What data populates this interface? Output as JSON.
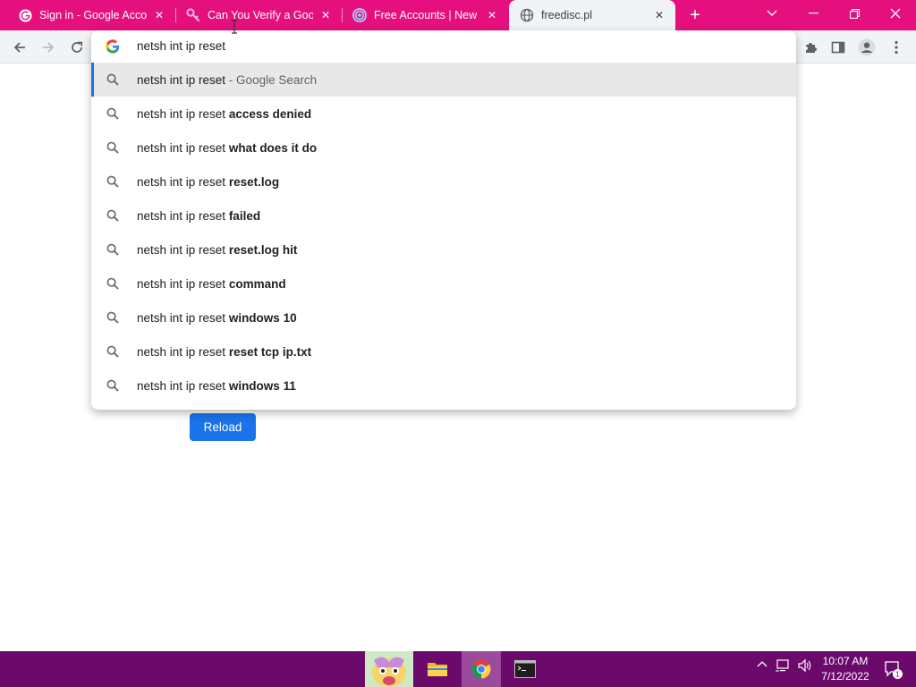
{
  "tabs": [
    {
      "title": "Sign in - Google Accou",
      "icon": "google-icon"
    },
    {
      "title": "Can You Verify a Googl",
      "icon": "pink-key-icon"
    },
    {
      "title": "Free Accounts | New Fr",
      "icon": "swirl-icon"
    },
    {
      "title": "freedisc.pl",
      "icon": "globe-icon",
      "active": true
    }
  ],
  "omnibox": {
    "value": "netsh int ip reset",
    "suggestions": [
      {
        "prefix": "netsh int ip reset",
        "bold": "",
        "suffix": " - Google Search",
        "selected": true
      },
      {
        "prefix": "netsh int ip reset ",
        "bold": "access denied",
        "suffix": ""
      },
      {
        "prefix": "netsh int ip reset ",
        "bold": "what does it do",
        "suffix": ""
      },
      {
        "prefix": "netsh int ip reset ",
        "bold": "reset.log",
        "suffix": ""
      },
      {
        "prefix": "netsh int ip reset ",
        "bold": "failed",
        "suffix": ""
      },
      {
        "prefix": "netsh int ip reset ",
        "bold": "reset.log hit",
        "suffix": ""
      },
      {
        "prefix": "netsh int ip reset ",
        "bold": "command",
        "suffix": ""
      },
      {
        "prefix": "netsh int ip reset ",
        "bold": "windows 10",
        "suffix": ""
      },
      {
        "prefix": "netsh int ip reset ",
        "bold": "reset tcp ip.txt",
        "suffix": ""
      },
      {
        "prefix": "netsh int ip reset ",
        "bold": "windows 11",
        "suffix": ""
      }
    ]
  },
  "page": {
    "reload_label": "Reload"
  },
  "taskbar": {
    "apps": [
      "avatar-app-icon",
      "file-explorer-icon",
      "chrome-icon",
      "terminal-icon"
    ],
    "time": "10:07 AM",
    "date": "7/12/2022",
    "notification_count": "1"
  },
  "colors": {
    "tab_bar": "#e5107d",
    "taskbar": "#6b0a6b",
    "accent": "#1a73e8"
  }
}
